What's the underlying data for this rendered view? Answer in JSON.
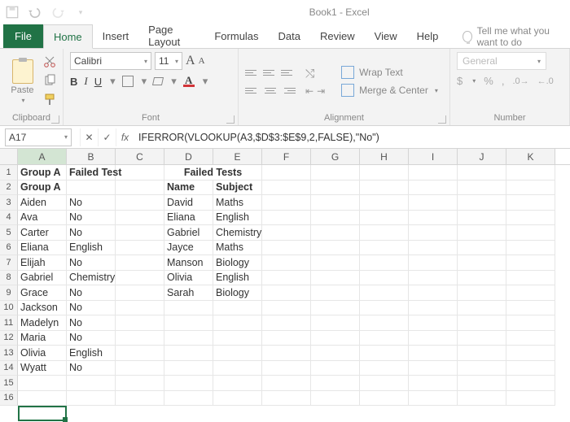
{
  "app_title": "Book1 - Excel",
  "tabs": {
    "file": "File",
    "home": "Home",
    "insert": "Insert",
    "page_layout": "Page Layout",
    "formulas": "Formulas",
    "data": "Data",
    "review": "Review",
    "view": "View",
    "help": "Help"
  },
  "tell_me": "Tell me what you want to do",
  "ribbon": {
    "clipboard": {
      "label": "Clipboard",
      "paste": "Paste"
    },
    "font": {
      "label": "Font",
      "name": "Calibri",
      "size": "11",
      "bold": "B",
      "italic": "I",
      "underline": "U",
      "fc_letter": "A"
    },
    "alignment": {
      "label": "Alignment",
      "wrap": "Wrap Text",
      "merge": "Merge & Center"
    },
    "number": {
      "label": "Number",
      "format": "General",
      "currency": "$",
      "percent": "%",
      "comma": ","
    }
  },
  "formula_bar": {
    "name_box": "A17",
    "fx": "fx",
    "formula": "IFERROR(VLOOKUP(A3,$D$3:$E$9,2,FALSE),\"No\")"
  },
  "columns": [
    "A",
    "B",
    "C",
    "D",
    "E",
    "F",
    "G",
    "H",
    "I",
    "J",
    "K"
  ],
  "selected_cell": {
    "row": 17,
    "col": "A"
  },
  "cells": {
    "1": {
      "A": {
        "v": "Group A",
        "b": true
      },
      "B": {
        "v": "Failed Test",
        "b": true
      },
      "D": {
        "v": "Failed Tests",
        "b": true,
        "merge": "DE"
      }
    },
    "2": {
      "A": {
        "v": "Group A",
        "b": true
      },
      "D": {
        "v": "Name",
        "b": true
      },
      "E": {
        "v": "Subject",
        "b": true
      }
    },
    "3": {
      "A": {
        "v": "Aiden"
      },
      "B": {
        "v": "No"
      },
      "D": {
        "v": "David"
      },
      "E": {
        "v": "Maths"
      }
    },
    "4": {
      "A": {
        "v": "Ava"
      },
      "B": {
        "v": "No"
      },
      "D": {
        "v": "Eliana"
      },
      "E": {
        "v": "English"
      }
    },
    "5": {
      "A": {
        "v": "Carter"
      },
      "B": {
        "v": "No"
      },
      "D": {
        "v": "Gabriel"
      },
      "E": {
        "v": "Chemistry"
      }
    },
    "6": {
      "A": {
        "v": "Eliana"
      },
      "B": {
        "v": "English"
      },
      "D": {
        "v": "Jayce"
      },
      "E": {
        "v": "Maths"
      }
    },
    "7": {
      "A": {
        "v": "Elijah"
      },
      "B": {
        "v": "No"
      },
      "D": {
        "v": "Manson"
      },
      "E": {
        "v": "Biology"
      }
    },
    "8": {
      "A": {
        "v": "Gabriel"
      },
      "B": {
        "v": "Chemistry"
      },
      "D": {
        "v": "Olivia"
      },
      "E": {
        "v": "English"
      }
    },
    "9": {
      "A": {
        "v": "Grace"
      },
      "B": {
        "v": "No"
      },
      "D": {
        "v": "Sarah"
      },
      "E": {
        "v": "Biology"
      }
    },
    "10": {
      "A": {
        "v": "Jackson"
      },
      "B": {
        "v": "No"
      }
    },
    "11": {
      "A": {
        "v": "Madelyn"
      },
      "B": {
        "v": "No"
      }
    },
    "12": {
      "A": {
        "v": "Maria"
      },
      "B": {
        "v": "No"
      }
    },
    "13": {
      "A": {
        "v": "Olivia"
      },
      "B": {
        "v": "English"
      }
    },
    "14": {
      "A": {
        "v": "Wyatt"
      },
      "B": {
        "v": "No"
      }
    },
    "15": {},
    "16": {}
  }
}
